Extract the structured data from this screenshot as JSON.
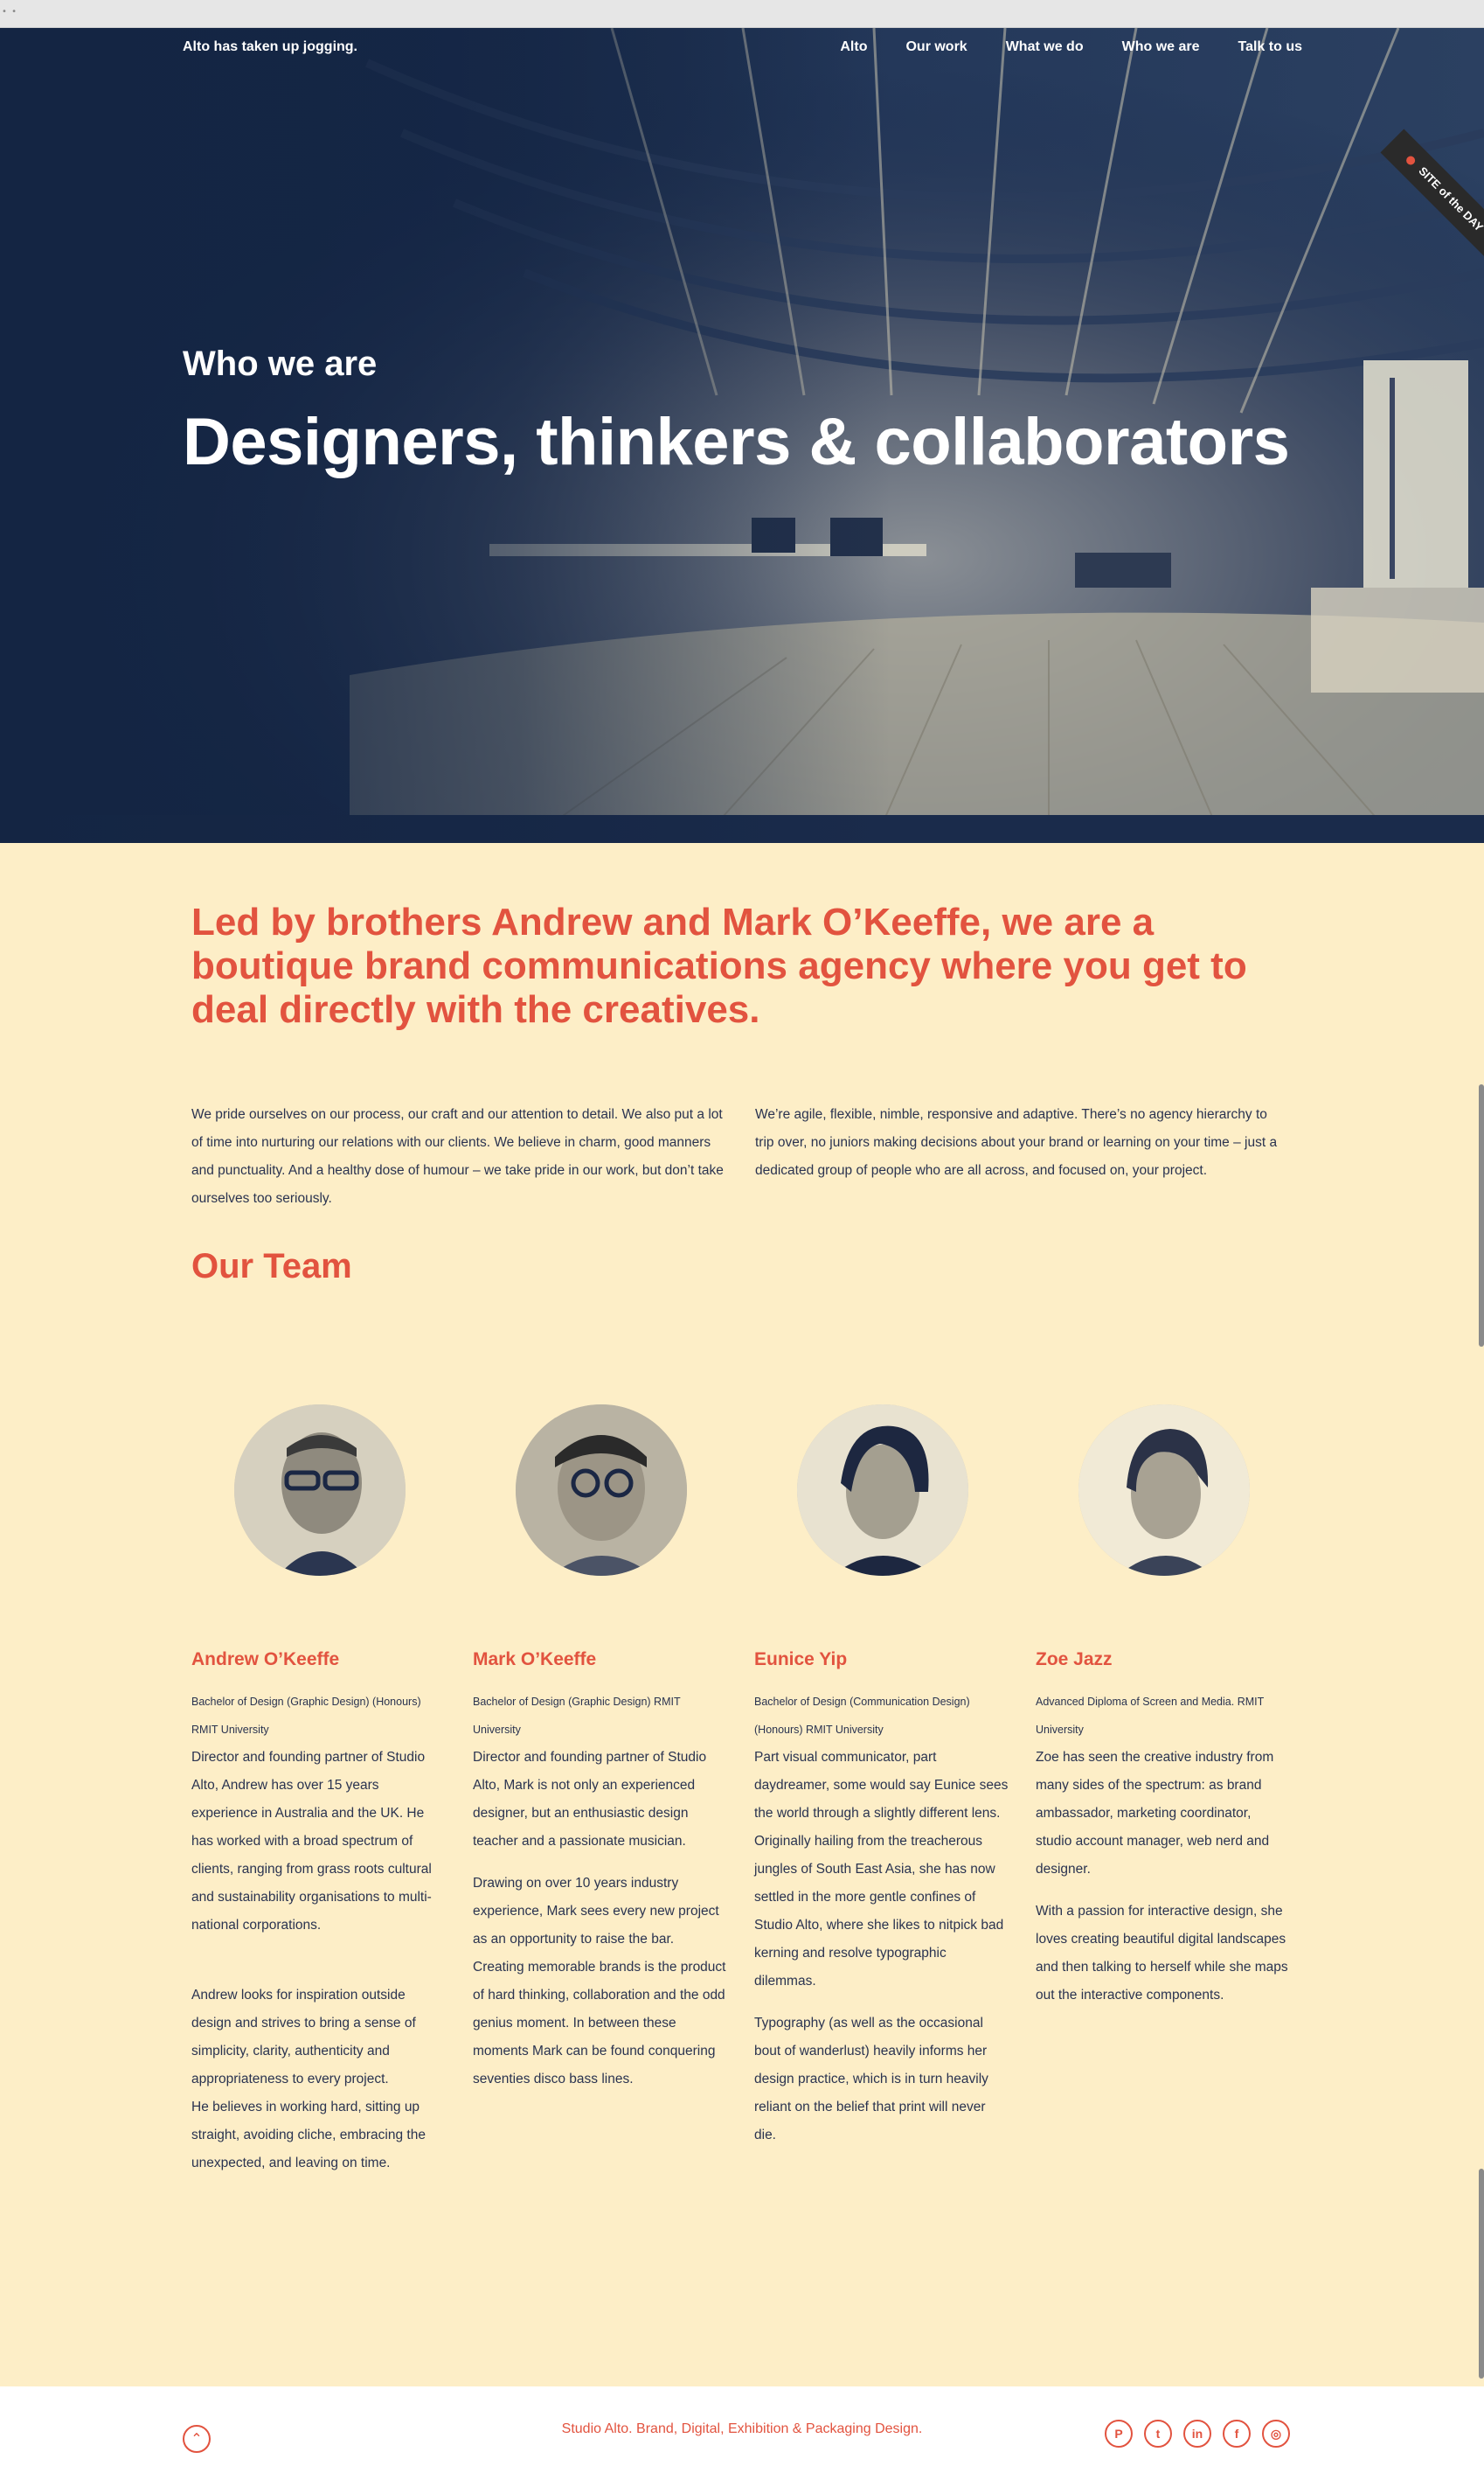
{
  "header": {
    "tagline": "Alto has taken up jogging.",
    "nav": [
      "Alto",
      "Our work",
      "What we do",
      "Who we are",
      "Talk to us"
    ]
  },
  "hero": {
    "kicker": "Who we are",
    "title": "Designers, thinkers & collaborators",
    "ribbon_a": "SITE of",
    "ribbon_b": "the DAY"
  },
  "intro": {
    "lead": "Led by brothers Andrew and Mark O’Keeffe, we are a boutique brand communications agency where you get to deal directly with the creatives.",
    "left": "We pride ourselves on our process, our craft and our attention to detail. We also put a lot of time into nurturing our relations with our clients. We believe in charm, good manners and punctuality. And a healthy dose of humour – we take pride in our work, but don’t take ourselves too seriously.",
    "right": "We’re agile, flexible, nimble, responsive and adaptive. There’s no agency hierarchy to trip over, no juniors making decisions about your brand or learning on your time – just a dedicated group of people who are all across, and focused on, your project."
  },
  "team": {
    "title": "Our Team",
    "members": [
      {
        "name": "Andrew O’Keeffe",
        "degree": "Bachelor of Design (Graphic Design) (Honours) RMIT University",
        "bio1": "Director and founding partner of Studio Alto, Andrew has over 15 years experience in Australia and the UK. He has worked with a broad spectrum of clients, ranging from grass roots cultural and sustainability organisations to multi-national corporations.",
        "bio2": "Andrew looks for inspiration outside design and strives to bring a sense of simplicity, clarity, authenticity and appropriateness to every project.",
        "bio3": "He believes in working hard, sitting up straight, avoiding cliche, embracing the unexpected, and leaving on time."
      },
      {
        "name": "Mark O’Keeffe",
        "degree": "Bachelor of Design (Graphic Design) RMIT University",
        "bio1": "Director and founding partner of Studio Alto, Mark is not only an experienced designer, but an enthusiastic design teacher and a passionate musician.",
        "bio2": "Drawing on over 10 years industry experience, Mark sees every new project as an opportunity to raise the bar. Creating memorable brands is the product of hard thinking, collaboration and the odd genius moment. In between these moments Mark can be found conquering seventies disco bass lines."
      },
      {
        "name": "Eunice Yip",
        "degree": "Bachelor of Design (Communication Design) (Honours) RMIT University",
        "bio1": "Part visual communicator, part daydreamer, some would say Eunice sees the world through a slightly different lens. Originally hailing from the treacherous jungles of South East Asia, she has now settled in the more gentle confines of Studio Alto, where she likes to nitpick bad kerning and resolve typographic dilemmas.",
        "bio2": "Typography (as well as the occasional bout of wanderlust) heavily informs her design practice, which is in turn heavily reliant on the belief that print will never die."
      },
      {
        "name": "Zoe Jazz",
        "degree": "Advanced Diploma of Screen and Media. RMIT University",
        "bio1": "Zoe has seen the creative industry from many sides of the spectrum: as brand ambassador, marketing coordinator, studio account manager, web nerd and designer.",
        "bio2": "With a passion for interactive design, she loves creating beautiful digital landscapes and then talking to herself while she maps out the interactive components."
      }
    ]
  },
  "footer": {
    "text": "Studio Alto. Brand, Digital, Exhibition & Packaging Design.",
    "social": [
      "pinterest-icon",
      "twitter-icon",
      "linkedin-icon",
      "facebook-icon",
      "instagram-icon"
    ],
    "social_glyphs": [
      "P",
      "t",
      "in",
      "f",
      "◎"
    ],
    "up_glyph": "⌃"
  },
  "colors": {
    "accent": "#e2533f",
    "hero_bg": "#142543",
    "page_bg": "#fdeec7",
    "footer_bg": "#ffffff"
  }
}
